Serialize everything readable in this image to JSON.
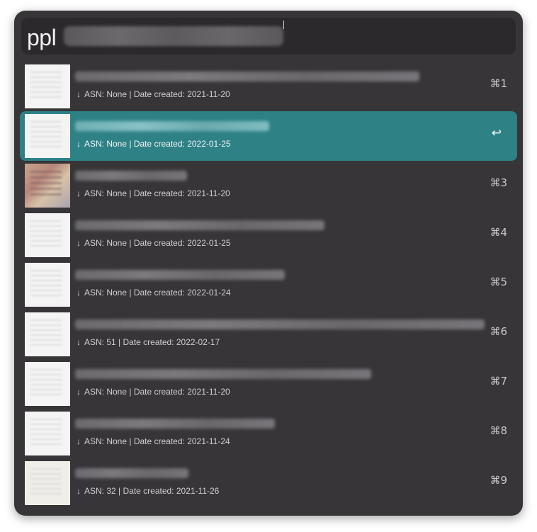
{
  "search": {
    "query": "ppl"
  },
  "results": [
    {
      "meta_prefix": "↓",
      "meta": "ASN: None | Date created: 2021-11-20",
      "shortcut": "⌘1"
    },
    {
      "meta_prefix": "↓",
      "meta": "ASN: None | Date created: 2022-01-25",
      "shortcut": "↩"
    },
    {
      "meta_prefix": "↓",
      "meta": "ASN: None | Date created: 2021-11-20",
      "shortcut": "⌘3"
    },
    {
      "meta_prefix": "↓",
      "meta": "ASN: None | Date created: 2022-01-25",
      "shortcut": "⌘4"
    },
    {
      "meta_prefix": "↓",
      "meta": "ASN: None | Date created: 2022-01-24",
      "shortcut": "⌘5"
    },
    {
      "meta_prefix": "↓",
      "meta": "ASN: 51 | Date created: 2022-02-17",
      "shortcut": "⌘6"
    },
    {
      "meta_prefix": "↓",
      "meta": "ASN: None | Date created: 2021-11-20",
      "shortcut": "⌘7"
    },
    {
      "meta_prefix": "↓",
      "meta": "ASN: None | Date created: 2021-11-24",
      "shortcut": "⌘8"
    },
    {
      "meta_prefix": "↓",
      "meta": "ASN: 32 | Date created: 2021-11-26",
      "shortcut": "⌘9"
    }
  ],
  "colors": {
    "window_bg": "#373538",
    "search_bg": "#2b292c",
    "selected_row": "#2e8185"
  }
}
